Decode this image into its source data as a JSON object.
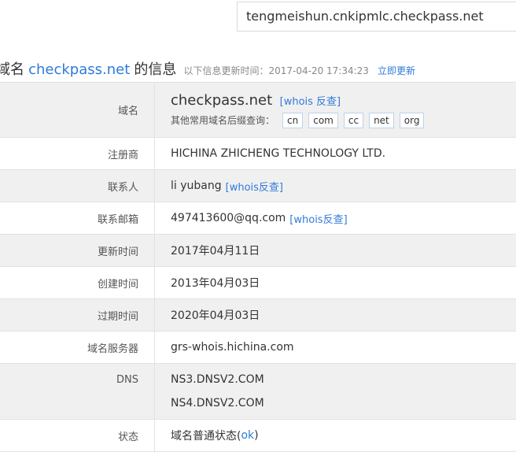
{
  "search": {
    "value": "tengmeishun.cnkipmlc.checkpass.net"
  },
  "heading": {
    "prefix": "域名",
    "domain": "checkpass.net",
    "suffix": "的信息",
    "update_text": "以下信息更新时间：2017-04-20 17:34:23",
    "refresh_label": "立即更新"
  },
  "rows": {
    "domain": {
      "label": "域名",
      "value": "checkpass.net",
      "whois_link": "[whois 反查]",
      "suffix_label": "其他常用域名后缀查询：",
      "suffixes": [
        "cn",
        "com",
        "cc",
        "net",
        "org"
      ]
    },
    "registrar": {
      "label": "注册商",
      "value": "HICHINA ZHICHENG TECHNOLOGY LTD."
    },
    "contact": {
      "label": "联系人",
      "value": "li yubang",
      "whois_link": "[whois反查]"
    },
    "email": {
      "label": "联系邮箱",
      "value": "497413600@qq.com",
      "whois_link": "[whois反查]"
    },
    "updated": {
      "label": "更新时间",
      "value": "2017年04月11日"
    },
    "created": {
      "label": "创建时间",
      "value": "2013年04月03日"
    },
    "expires": {
      "label": "过期时间",
      "value": "2020年04月03日"
    },
    "nameserver": {
      "label": "域名服务器",
      "value": "grs-whois.hichina.com"
    },
    "dns": {
      "label": "DNS",
      "values": [
        "NS3.DNSV2.COM",
        "NS4.DNSV2.COM"
      ]
    },
    "status": {
      "label": "状态",
      "prefix": "域名普通状态(",
      "link": "ok",
      "suffix": ")"
    }
  }
}
